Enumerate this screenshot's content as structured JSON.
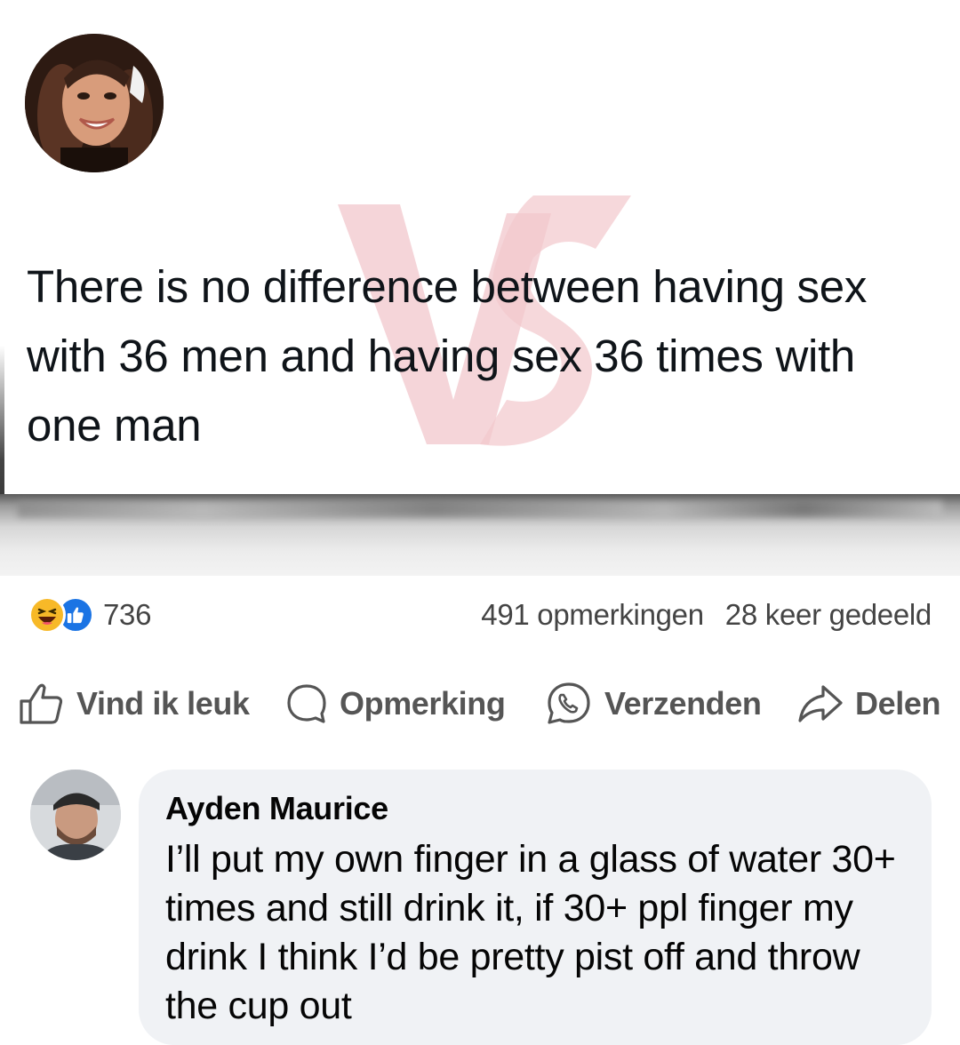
{
  "tweet": {
    "text": "There is no difference between having sex with 36 men and having sex 36 times with one man"
  },
  "stats": {
    "reaction_count": "736",
    "comments": "491 opmerkingen",
    "shares": "28 keer gedeeld"
  },
  "actions": {
    "like": "Vind ik leuk",
    "comment": "Opmerking",
    "send": "Verzenden",
    "share": "Delen"
  },
  "comment": {
    "author": "Ayden Maurice",
    "text": "I’ll put my own finger in a glass of water 30+ times and still drink it, if 30+ ppl finger my drink I think I’d be pretty pist off and throw the cup out"
  },
  "icons": {
    "reaction_haha": "laughing-face-icon",
    "reaction_like": "thumbs-up-icon",
    "like": "thumbs-up-outline-icon",
    "comment": "speech-bubble-icon",
    "send": "whatsapp-icon",
    "share": "share-arrow-icon"
  },
  "colors": {
    "like_blue": "#1b74e4",
    "haha_yellow": "#f7b928",
    "comment_bubble": "#f0f2f5",
    "watermark_pink": "#f2c7cc"
  }
}
